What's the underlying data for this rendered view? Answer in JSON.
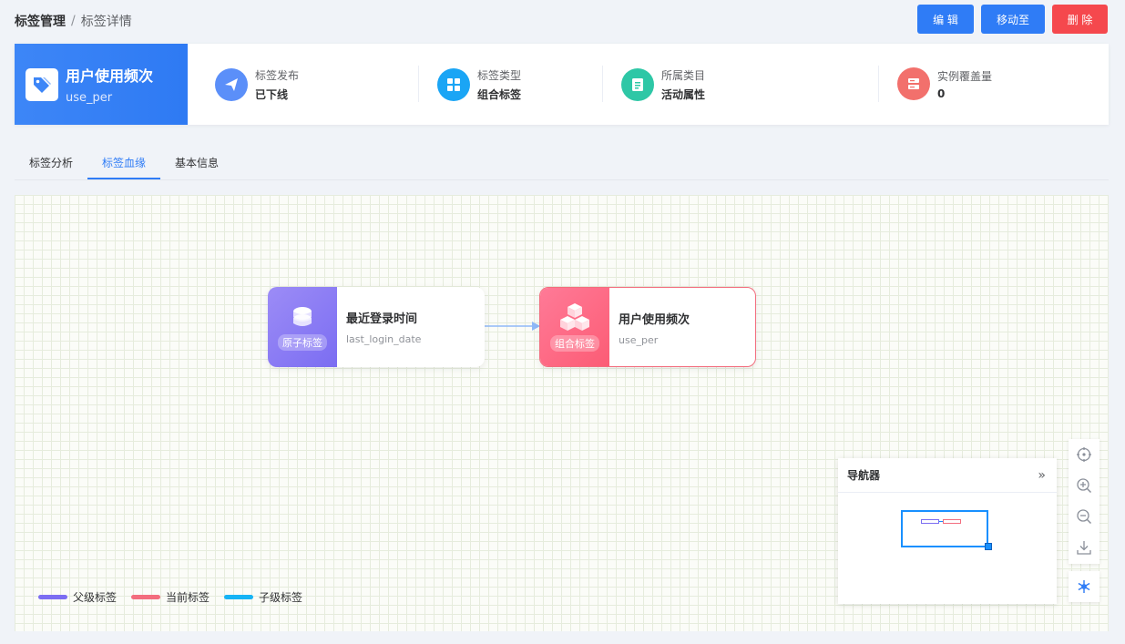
{
  "breadcrumb": {
    "root": "标签管理",
    "separator": "/",
    "current": "标签详情"
  },
  "actions": {
    "edit": "编 辑",
    "move": "移动至",
    "delete": "删 除"
  },
  "tag": {
    "name": "用户使用频次",
    "code": "use_per"
  },
  "stats": [
    {
      "label": "标签发布",
      "value": "已下线",
      "icon": "send-icon",
      "color": "#5b8ff9"
    },
    {
      "label": "标签类型",
      "value": "组合标签",
      "icon": "grid-icon",
      "color": "#1aa5f5"
    },
    {
      "label": "所属类目",
      "value": "活动属性",
      "icon": "document-icon",
      "color": "#2ec7a6"
    },
    {
      "label": "实例覆盖量",
      "value": "0",
      "icon": "database-icon",
      "color": "#f2706c"
    }
  ],
  "tabs": [
    {
      "label": "标签分析",
      "active": false
    },
    {
      "label": "标签血缘",
      "active": true
    },
    {
      "label": "基本信息",
      "active": false
    }
  ],
  "lineage": {
    "nodes": [
      {
        "badge": "原子标签",
        "name": "最近登录时间",
        "code": "last_login_date",
        "role": "parent"
      },
      {
        "badge": "组合标签",
        "name": "用户使用频次",
        "code": "use_per",
        "role": "current"
      }
    ]
  },
  "legend": [
    {
      "label": "父级标签",
      "color": "#7b6df2"
    },
    {
      "label": "当前标签",
      "color": "#f36d7e"
    },
    {
      "label": "子级标签",
      "color": "#16b3f5"
    }
  ],
  "navigator": {
    "title": "导航器",
    "collapse": "»"
  },
  "colors": {
    "primary": "#2f7cf6",
    "danger": "#f5484d"
  }
}
